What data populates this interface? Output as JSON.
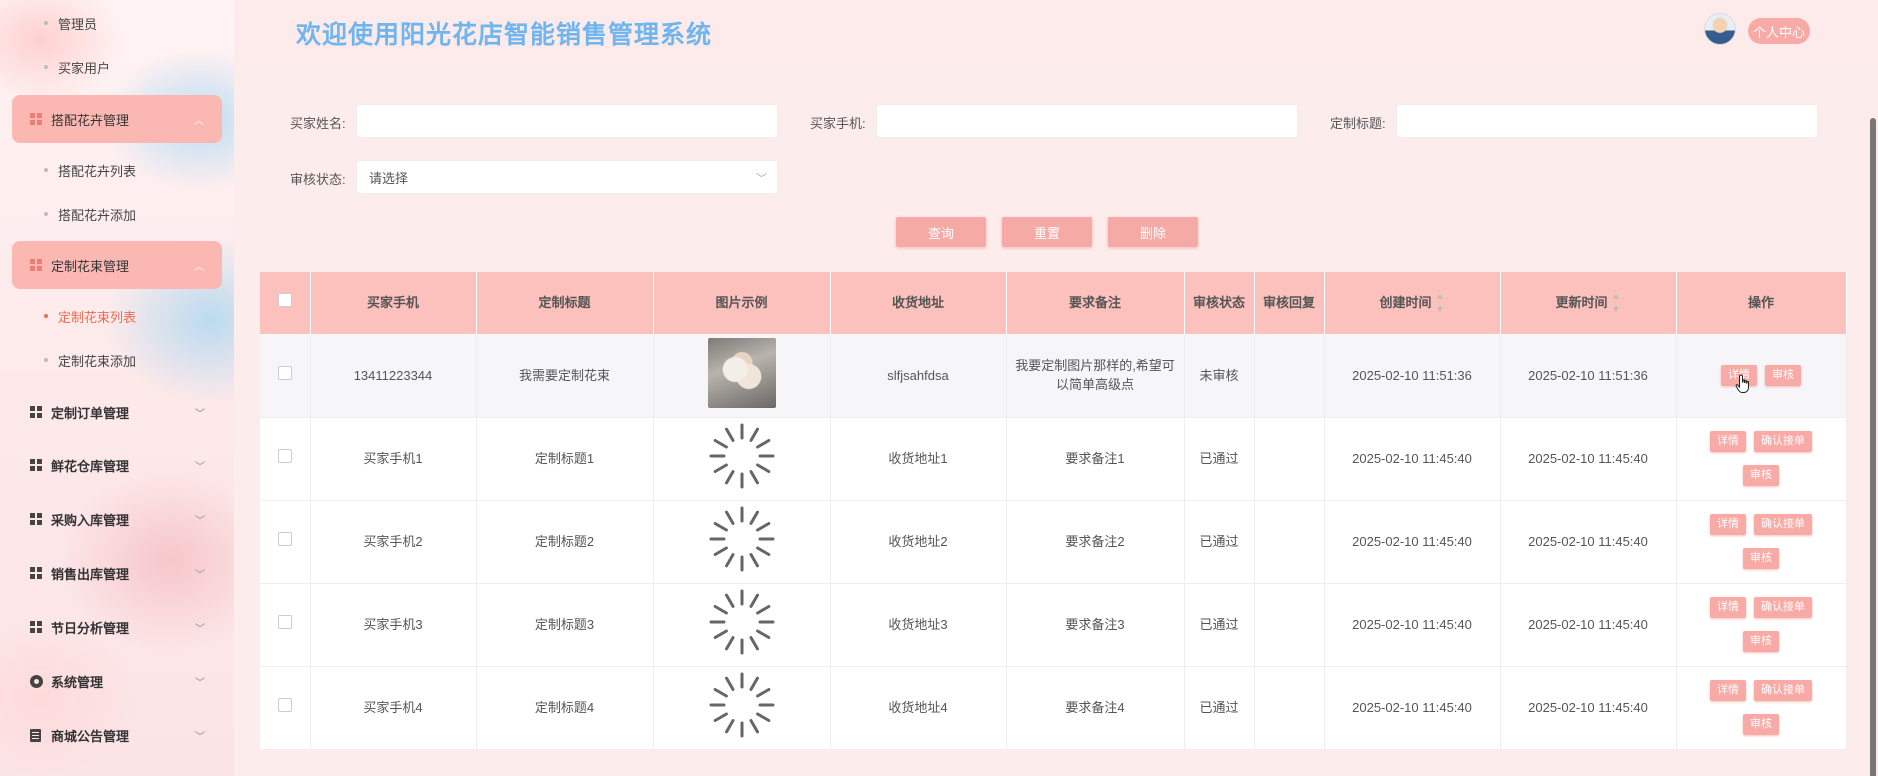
{
  "sidebar": {
    "items": [
      {
        "type": "sub",
        "label": "管理员",
        "active": false
      },
      {
        "type": "sub",
        "label": "买家用户",
        "active": false
      },
      {
        "type": "group",
        "label": "搭配花卉管理",
        "expanded": true,
        "icon": "grid-icon"
      },
      {
        "type": "sub",
        "label": "搭配花卉列表",
        "active": false
      },
      {
        "type": "sub",
        "label": "搭配花卉添加",
        "active": false
      },
      {
        "type": "group",
        "label": "定制花束管理",
        "expanded": true,
        "icon": "grid-icon"
      },
      {
        "type": "sub",
        "label": "定制花束列表",
        "active": true
      },
      {
        "type": "sub",
        "label": "定制花束添加",
        "active": false
      },
      {
        "type": "item",
        "label": "定制订单管理",
        "icon": "grid-icon"
      },
      {
        "type": "item",
        "label": "鲜花仓库管理",
        "icon": "grid-icon"
      },
      {
        "type": "item",
        "label": "采购入库管理",
        "icon": "grid-icon"
      },
      {
        "type": "item",
        "label": "销售出库管理",
        "icon": "grid-icon"
      },
      {
        "type": "item",
        "label": "节日分析管理",
        "icon": "grid-icon"
      },
      {
        "type": "item",
        "label": "系统管理",
        "icon": "gear-icon"
      },
      {
        "type": "item",
        "label": "商城公告管理",
        "icon": "doc-icon"
      }
    ]
  },
  "header": {
    "title": "欢迎使用阳光花店智能销售管理系统",
    "profile_label": "个人中心"
  },
  "search": {
    "buyer_name_label": "买家姓名:",
    "buyer_phone_label": "买家手机:",
    "custom_title_label": "定制标题:",
    "review_status_label": "审核状态:",
    "review_status_value": "请选择",
    "query_label": "查询",
    "reset_label": "重置",
    "delete_label": "删除"
  },
  "table": {
    "headers": {
      "phone": "买家手机",
      "title": "定制标题",
      "image": "图片示例",
      "address": "收货地址",
      "remark": "要求备注",
      "status": "审核状态",
      "reply": "审核回复",
      "created": "创建时间",
      "updated": "更新时间",
      "ops": "操作"
    },
    "rows": [
      {
        "phone": "13411223344",
        "title": "我需要定制花束",
        "image": "photo",
        "address": "slfjsahfdsa",
        "remark": "我要定制图片那样的,希望可以简单高级点",
        "status": "未审核",
        "reply": "",
        "created": "2025-02-10 11:51:36",
        "updated": "2025-02-10 11:51:36",
        "ops": [
          "详情",
          "审核"
        ]
      },
      {
        "phone": "买家手机1",
        "title": "定制标题1",
        "image": "loading",
        "address": "收货地址1",
        "remark": "要求备注1",
        "status": "已通过",
        "reply": "",
        "created": "2025-02-10 11:45:40",
        "updated": "2025-02-10 11:45:40",
        "ops": [
          "详情",
          "确认接单",
          "审核"
        ]
      },
      {
        "phone": "买家手机2",
        "title": "定制标题2",
        "image": "loading",
        "address": "收货地址2",
        "remark": "要求备注2",
        "status": "已通过",
        "reply": "",
        "created": "2025-02-10 11:45:40",
        "updated": "2025-02-10 11:45:40",
        "ops": [
          "详情",
          "确认接单",
          "审核"
        ]
      },
      {
        "phone": "买家手机3",
        "title": "定制标题3",
        "image": "loading",
        "address": "收货地址3",
        "remark": "要求备注3",
        "status": "已通过",
        "reply": "",
        "created": "2025-02-10 11:45:40",
        "updated": "2025-02-10 11:45:40",
        "ops": [
          "详情",
          "确认接单",
          "审核"
        ]
      },
      {
        "phone": "买家手机4",
        "title": "定制标题4",
        "image": "loading",
        "address": "收货地址4",
        "remark": "要求备注4",
        "status": "已通过",
        "reply": "",
        "created": "2025-02-10 11:45:40",
        "updated": "2025-02-10 11:45:40",
        "ops": [
          "详情",
          "确认接单",
          "审核"
        ]
      }
    ]
  },
  "colors": {
    "accent": "#f8aaa6",
    "title_blue": "#6fb5ef",
    "active_link": "#f06a52",
    "header_row": "#fcc1bc"
  }
}
